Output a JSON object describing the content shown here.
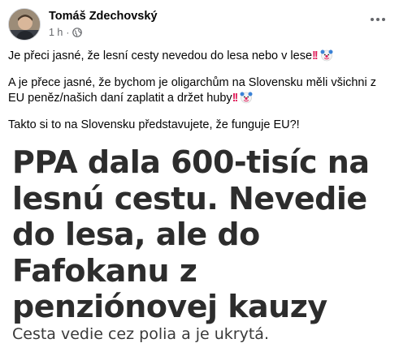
{
  "post": {
    "author": "Tomáš Zdechovský",
    "time": "1 h",
    "separator": "·",
    "paragraphs": [
      "Je přeci jasné, že lesní cesty nevedou do lesa nebo v lese",
      "A je přece jasné, že bychom je oligarchům na Slovensku měli všichni z EU peněz/našich daní zaplatit a držet huby",
      "Takto si to na Slovensku představujete, že funguje EU?!"
    ],
    "image": {
      "headline": "PPA dala 600-tisíc na lesnú cestu. Nevedie do lesa, ale do Fafokanu z penziónovej kauzy",
      "subline": "Cesta vedie cez polia a je ukrytá."
    }
  },
  "icons": {
    "avatar": "profile-photo",
    "privacy": "globe-icon",
    "more": "more-horizontal-icon",
    "exclamation": "double-exclamation-emoji",
    "clown": "clown-face-emoji"
  },
  "colors": {
    "name": "#050505",
    "meta": "#65676b",
    "exclamation": "#e0245e",
    "headline": "#2d2d2d"
  }
}
